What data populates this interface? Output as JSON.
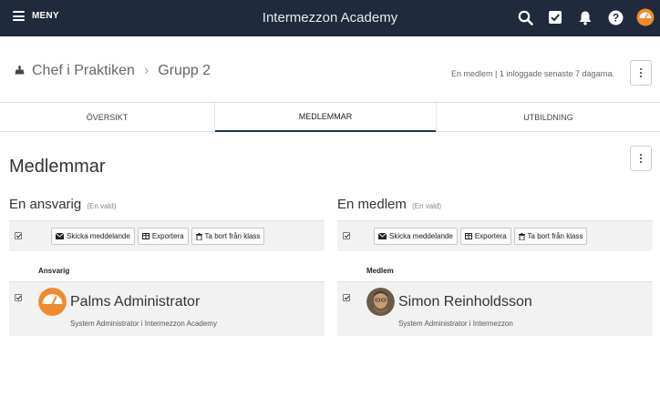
{
  "topbar": {
    "menu_label": "MENY",
    "title": "Intermezzon Academy",
    "icons": [
      "search-icon",
      "tasks-check-icon",
      "bell-icon",
      "help-icon",
      "profile-logo-icon"
    ],
    "color": "#1f2a3c"
  },
  "header": {
    "breadcrumb": [
      "Chef i Praktiken",
      "Grupp 2"
    ],
    "separator": "›",
    "status": "En medlem | 1 inloggade senaste 7 dagarna."
  },
  "tabs": [
    {
      "label": "ÖVERSIKT",
      "active": false
    },
    {
      "label": "MEDLEMMAR",
      "active": true
    },
    {
      "label": "UTBILDNING",
      "active": false
    }
  ],
  "page_title": "Medlemmar",
  "groups": [
    {
      "title": "En ansvarig",
      "selection": "(En vald)",
      "actions": {
        "message": "Skicka meddelande",
        "export": "Exportera",
        "remove": "Ta bort från klass"
      },
      "column_header": "Ansvarig",
      "members": [
        {
          "name": "Palms Administrator",
          "role": "System Administrator i Intermezzon Academy",
          "avatar": "orange-logo-avatar",
          "checked": true
        }
      ]
    },
    {
      "title": "En medlem",
      "selection": "(En vald)",
      "actions": {
        "message": "Skicka meddelande",
        "export": "Exportera",
        "remove": "Ta bort från klass"
      },
      "column_header": "Medlem",
      "members": [
        {
          "name": "Simon Reinholdsson",
          "role": "System Administrator i Intermezzon",
          "avatar": "user-photo-avatar",
          "checked": true
        }
      ]
    }
  ],
  "colors": {
    "accent_orange": "#f08a2c",
    "tab_active_underline": "#1f3550",
    "panel_bg": "#f2f2f2"
  }
}
